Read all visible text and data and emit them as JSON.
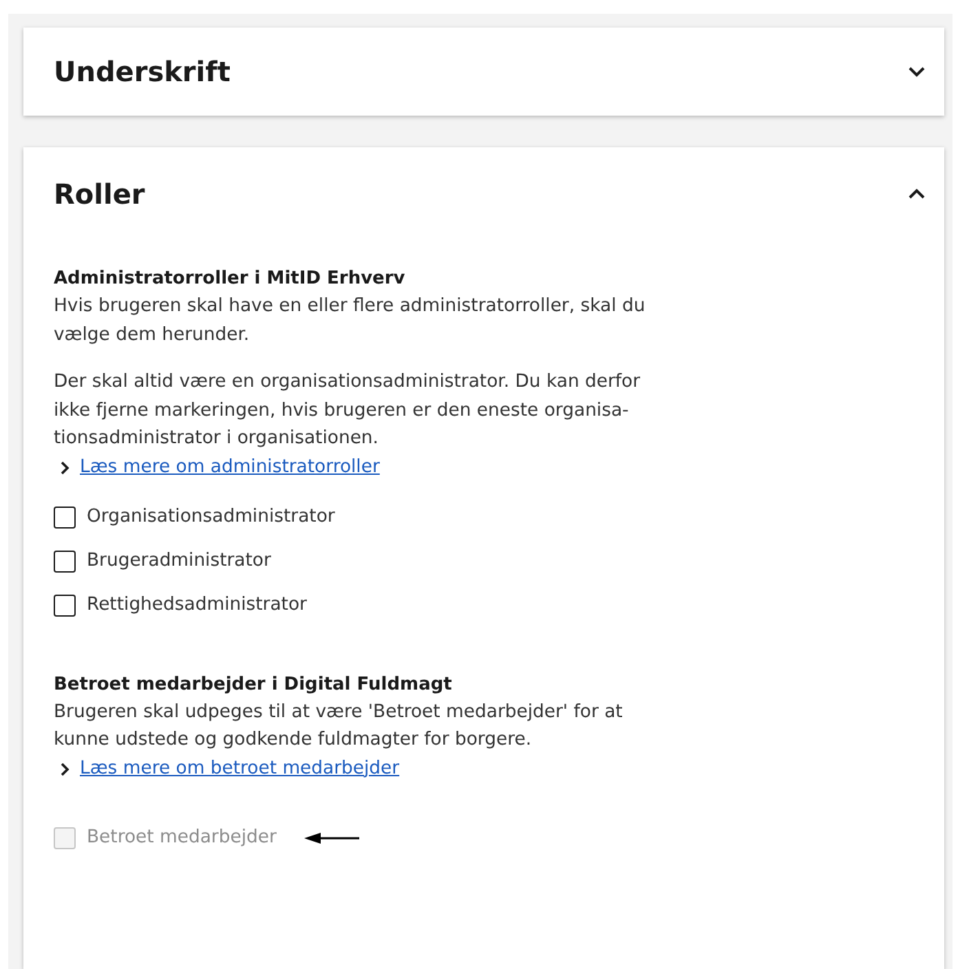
{
  "sections": [
    {
      "title": "Underskrift",
      "expanded": false
    },
    {
      "title": "Roller",
      "expanded": true,
      "groups": [
        {
          "heading": "Administratorroller i MitID Erhverv",
          "paragraphs": [
            [
              "Hvis brugeren skal have en eller flere administratorroller, skal du",
              "vælge dem herunder."
            ],
            [
              "Der skal altid være en organisationsadministrator. Du kan derfor",
              "ikke fjerne markeringen, hvis brugeren er den eneste organisa-",
              "tionsadministrator i organisationen."
            ]
          ],
          "link": "Læs mere om administratorroller",
          "checkboxes": [
            {
              "label": "Organisationsadministrator",
              "checked": false,
              "disabled": false
            },
            {
              "label": "Brugeradministrator",
              "checked": false,
              "disabled": false
            },
            {
              "label": "Rettighedsadministrator",
              "checked": false,
              "disabled": false
            }
          ]
        },
        {
          "heading": "Betroet medarbejder i Digital Fuldmagt",
          "paragraphs": [
            [
              "Brugeren skal udpeges til at være 'Betroet medarbejder' for at",
              "kunne udstede og godkende fuldmagter for borgere."
            ]
          ],
          "link": "Læs mere om betroet medarbejder",
          "checkboxes": [
            {
              "label": "Betroet medarbejder",
              "checked": false,
              "disabled": true,
              "pointer": true
            }
          ]
        }
      ]
    }
  ]
}
